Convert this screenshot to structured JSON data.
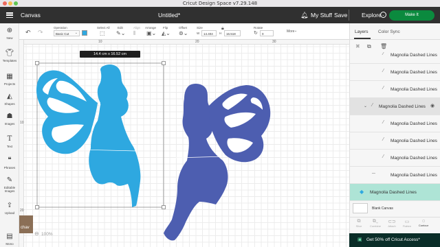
{
  "titlebar": {
    "title": "Cricut Design Space  v7.29.148"
  },
  "header": {
    "menu_icon": "hamburger-icon",
    "section": "Canvas",
    "doc_title": "Untitled*",
    "bell_icon": "bell-icon",
    "mystuff": "My Stuff",
    "save": "Save",
    "machine": "Explore",
    "make": "Make It"
  },
  "toolbar": {
    "undo_icon": "undo-icon",
    "redo_icon": "redo-icon",
    "operation_label": "Operation",
    "operation_value": "Basic Cut",
    "select_all": "Select All",
    "edit": "Edit",
    "align": "Align",
    "arrange": "Arrange",
    "flip": "Flip",
    "offset": "Offset",
    "size_label": "Size",
    "w_label": "W",
    "w_value": "14.404",
    "h_label": "H",
    "h_value": "16.518",
    "rotate_label": "Rotate",
    "rotate_value": "0",
    "more": "More"
  },
  "sidebar": {
    "items": [
      {
        "icon": "plus-icon",
        "label": "New"
      },
      {
        "icon": "shirt-icon",
        "label": "Templates"
      },
      {
        "icon": "grid-icon",
        "label": "Projects"
      },
      {
        "icon": "shapes-icon",
        "label": "Shapes"
      },
      {
        "icon": "image-icon",
        "label": "Images"
      },
      {
        "icon": "text-icon",
        "label": "Text"
      },
      {
        "icon": "phrases-icon",
        "label": "Phrases"
      },
      {
        "icon": "editable-images-icon",
        "label": "Editable Images"
      },
      {
        "icon": "upload-icon",
        "label": "Upload"
      },
      {
        "icon": "monogram-icon",
        "label": "Mono"
      }
    ]
  },
  "canvas": {
    "ruler_numbers": [
      "10",
      "20",
      "30"
    ],
    "ruler_left": [
      "10",
      "20"
    ],
    "dims_tag": "14.4 cm x 16.52 cm",
    "zoom": "100%",
    "watermark": "chav",
    "colors": {
      "fairy_left": "#2ea8e0",
      "fairy_right": "#4d5eb0",
      "selection": "#555555"
    }
  },
  "layers_panel": {
    "tabs": [
      "Layers",
      "Color Sync"
    ],
    "rows": [
      {
        "label": "Magnolia Dashed Lines",
        "style": "normal"
      },
      {
        "label": "Magnolia Dashed Lines",
        "style": "normal"
      },
      {
        "label": "Magnolia Dashed Lines",
        "style": "normal"
      },
      {
        "label": "Magnolia Dashed Lines",
        "style": "selected"
      },
      {
        "label": "Magnolia Dashed Lines",
        "style": "normal"
      },
      {
        "label": "Magnolia Dashed Lines",
        "style": "normal"
      },
      {
        "label": "Magnolia Dashed Lines",
        "style": "normal"
      },
      {
        "label": "Magnolia Dashed Lines",
        "style": "normal"
      },
      {
        "label": "Magnolia Dashed Lines",
        "style": "group"
      }
    ],
    "blank_canvas": "Blank Canvas",
    "bottom_tools": [
      "Slice",
      "Combine",
      "Attach",
      "Flatten",
      "Contour"
    ],
    "promo": "Get 50% off Cricut Access*"
  }
}
